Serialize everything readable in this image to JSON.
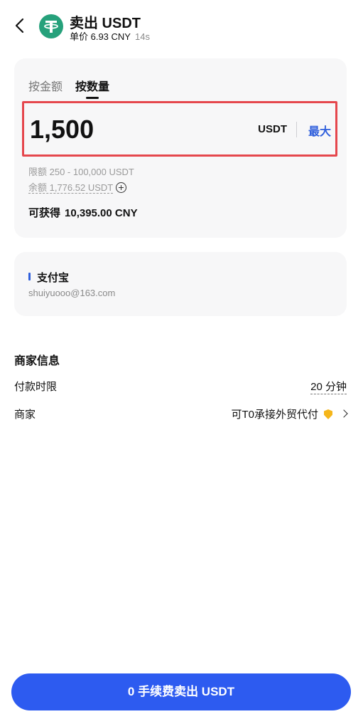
{
  "header": {
    "title": "卖出 USDT",
    "price_line": "单价 6.93 CNY",
    "timer": "14s"
  },
  "tabs": [
    "按金额",
    "按数量"
  ],
  "amount": {
    "value": "1,500",
    "unit": "USDT",
    "max_label": "最大"
  },
  "limit_text": "限额 250 - 100,000 USDT",
  "balance_text": "余额 1,776.52 USDT",
  "receive": {
    "label": "可获得",
    "value": "10,395.00 CNY"
  },
  "payment": {
    "name": "支付宝",
    "account": "shuiyuooo@163.com",
    "accent": "#2f5fdc"
  },
  "merchant": {
    "section_title": "商家信息",
    "time_limit_label": "付款时限",
    "time_limit_value": "20 分钟",
    "merchant_label": "商家",
    "merchant_name": "可T0承接外贸代付"
  },
  "sell_button_label": "0 手续费卖出 USDT",
  "icons": [
    "back-arrow-icon",
    "tether-icon",
    "add-circle-icon",
    "shield-icon",
    "chevron-right-icon"
  ],
  "colors": {
    "primary": "#2d5bf0",
    "tether": "#26A17B",
    "highlight_border": "#e5474d"
  }
}
